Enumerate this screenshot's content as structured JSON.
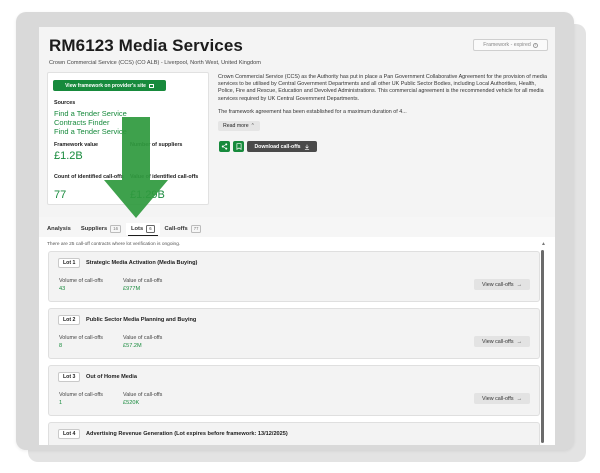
{
  "header": {
    "title": "RM6123 Media Services",
    "subtitle": "Crown Commercial Service (CCS) (CO ALB) - Liverpool, North West, United Kingdom",
    "status_badge": "Framework - expired",
    "view_framework_button": "View framework on provider's site",
    "sources_label": "Sources",
    "sources": [
      "Find a Tender Service",
      "Contracts Finder",
      "Find a Tender Service"
    ],
    "framework_value_label": "Framework value",
    "framework_value": "£1.2B",
    "suppliers_label": "Number of suppliers",
    "count_label": "Count of identified call-offs",
    "count_value": "77",
    "value_identified_label": "Value of identified call-offs",
    "value_identified": "£1.29B",
    "description": "Crown Commercial Service (CCS) as the Authority has put in place a Pan Government Collaborative Agreement for the provision of media services to be utilised by Central Government Departments and all other UK Public Sector Bodies, including Local Authorities, Health, Police, Fire and Rescue, Education and Devolved Administrations. This commercial agreement is the recommended vehicle for all media services required by UK Central Government Departments.",
    "description_2": "The framework agreement has been established for a maximum duration of 4...",
    "read_more": "Read more",
    "download_button": "Download call-offs"
  },
  "tabs": [
    {
      "label": "Analysis",
      "count": ""
    },
    {
      "label": "Suppliers",
      "count": "16"
    },
    {
      "label": "Lots",
      "count": "6"
    },
    {
      "label": "Call-offs",
      "count": "77"
    }
  ],
  "panel": {
    "note": "There are 25 call-off contracts where lot verification is ongoing.",
    "volume_label": "Volume of call-offs",
    "value_label": "Value of call-offs",
    "view_button": "View call-offs",
    "lots": [
      {
        "badge": "Lot 1",
        "title": "Strategic Media Activation (Media Buying)",
        "volume": "43",
        "value": "£977M"
      },
      {
        "badge": "Lot 2",
        "title": "Public Sector Media Planning and Buying",
        "volume": "8",
        "value": "£57.2M"
      },
      {
        "badge": "Lot 3",
        "title": "Out of Home Media",
        "volume": "1",
        "value": "£520K"
      },
      {
        "badge": "Lot 4",
        "title": "Advertising Revenue Generation (Lot expires before framework: 13/12/2025)",
        "volume": "",
        "value": ""
      }
    ]
  },
  "colors": {
    "accent_green": "#178a3c",
    "arrow_green": "#2f9a3e",
    "dark_button": "#4a4a4a"
  }
}
